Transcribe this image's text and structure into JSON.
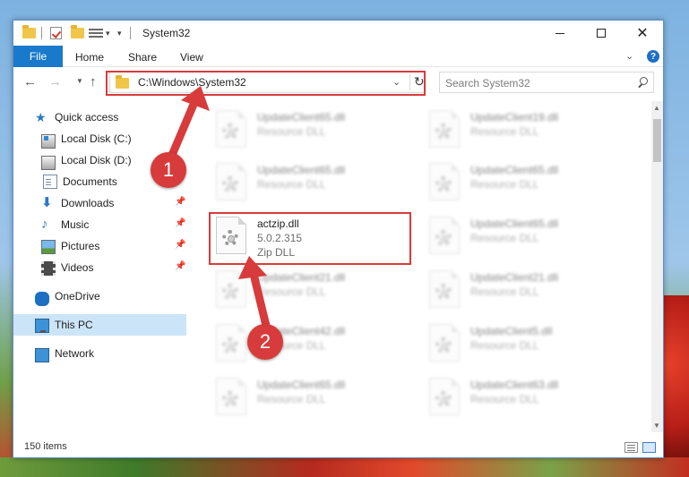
{
  "window": {
    "title": "System32"
  },
  "ribbon": {
    "file_label": "File",
    "tabs": [
      "Home",
      "Share",
      "View"
    ]
  },
  "address": {
    "path": "C:\\Windows\\System32"
  },
  "search": {
    "placeholder": "Search System32"
  },
  "sidebar": {
    "items": [
      {
        "label": "Quick access"
      },
      {
        "label": "Local Disk (C:)"
      },
      {
        "label": "Local Disk (D:)"
      },
      {
        "label": "Documents"
      },
      {
        "label": "Downloads"
      },
      {
        "label": "Music"
      },
      {
        "label": "Pictures"
      },
      {
        "label": "Videos"
      },
      {
        "label": "OneDrive"
      },
      {
        "label": "This PC"
      },
      {
        "label": "Network"
      }
    ]
  },
  "files": {
    "left": [
      {
        "name": "UpdateClient65.dll",
        "type": "Resource DLL"
      },
      {
        "name": "UpdateClient65.dll",
        "type": "Resource DLL"
      },
      {
        "name": "actzip.dll",
        "version": "5.0.2.315",
        "type": "Zip DLL"
      },
      {
        "name": "UpdateClient21.dll",
        "type": "Resource DLL"
      },
      {
        "name": "UpdateClient42.dll",
        "type": "Resource DLL"
      },
      {
        "name": "UpdateClient65.dll",
        "type": "Resource DLL"
      }
    ],
    "right": [
      {
        "name": "UpdateClient19.dll",
        "type": "Resource DLL"
      },
      {
        "name": "UpdateClient65.dll",
        "type": "Resource DLL"
      },
      {
        "name": "UpdateClient65.dll",
        "type": "Resource DLL"
      },
      {
        "name": "UpdateClient21.dll",
        "type": "Resource DLL"
      },
      {
        "name": "UpdateClient5.dll",
        "type": "Resource DLL"
      },
      {
        "name": "UpdateClient63.dll",
        "type": "Resource DLL"
      }
    ]
  },
  "status": {
    "item_count": "150 items"
  },
  "annotations": {
    "step1": "1",
    "step2": "2",
    "color": "#d83b3b"
  }
}
